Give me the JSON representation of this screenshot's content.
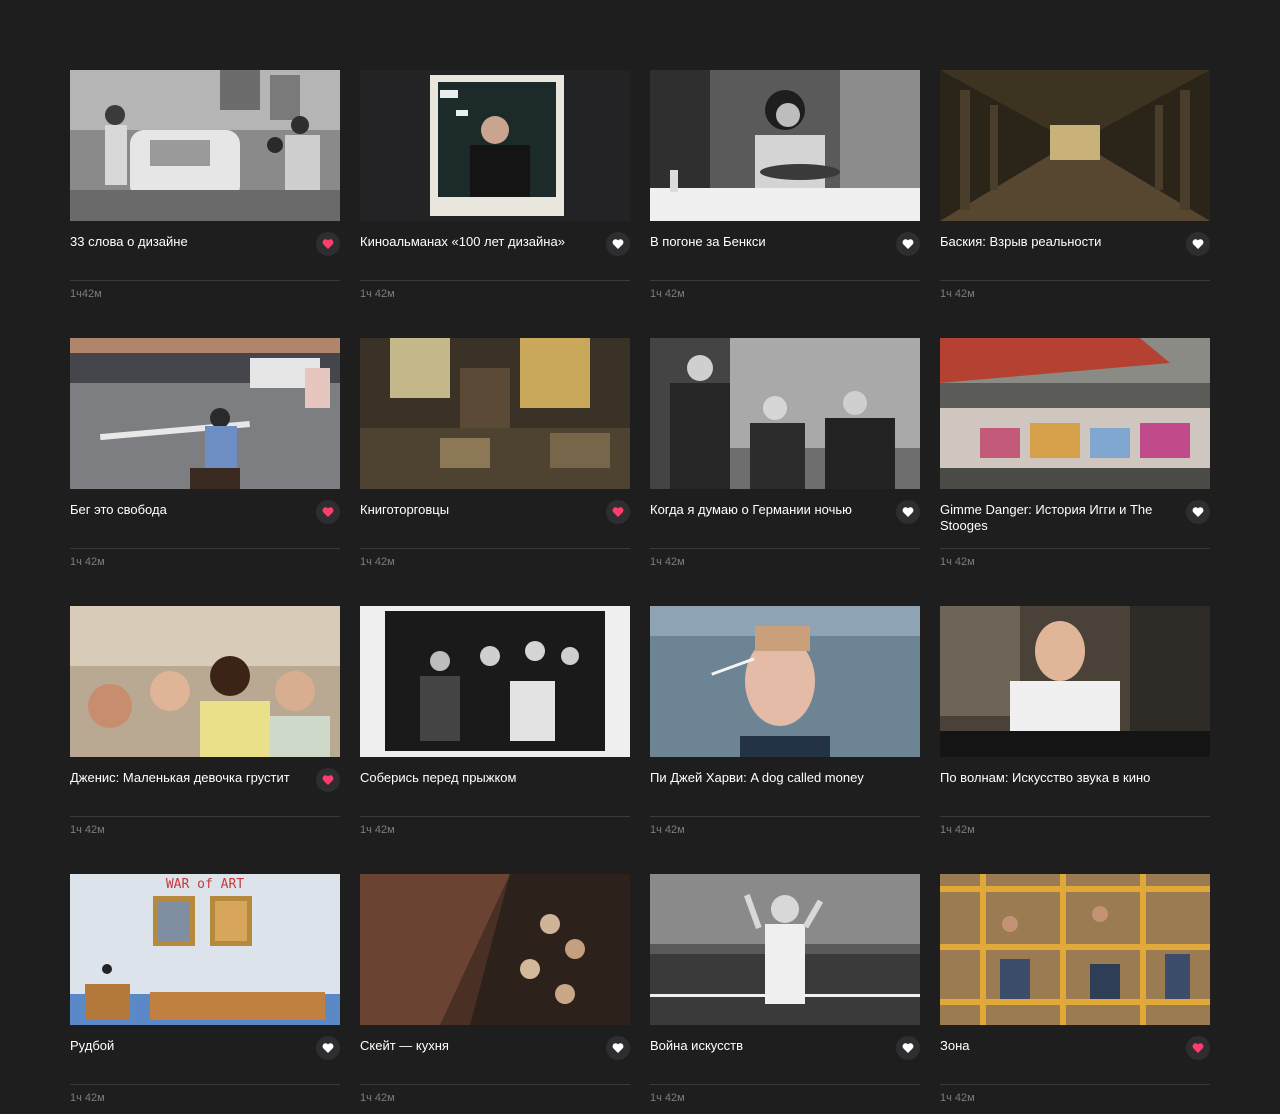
{
  "colors": {
    "background": "#1e1e1f",
    "favorite_active": "#ff3d6e",
    "favorite_inactive": "#ffffff",
    "duration_text": "#7c7c80"
  },
  "films": [
    {
      "title": "33 слова о дизайне",
      "duration": "1ч42м",
      "favorite": true,
      "icon": "heart-icon"
    },
    {
      "title": "Киноальманах «100 лет дизайна»",
      "duration": "1ч 42м",
      "favorite": false,
      "icon": "heart-icon"
    },
    {
      "title": "В погоне за Бенкси",
      "duration": "1ч 42м",
      "favorite": false,
      "icon": "heart-icon"
    },
    {
      "title": "Баския: Взрыв реальности",
      "duration": "1ч 42м",
      "favorite": false,
      "icon": "heart-icon"
    },
    {
      "title": "Бег это свобода",
      "duration": "1ч 42м",
      "favorite": true,
      "icon": "heart-icon"
    },
    {
      "title": "Книготорговцы",
      "duration": "1ч 42м",
      "favorite": true,
      "icon": "heart-icon"
    },
    {
      "title": "Когда я думаю о Германии ночью",
      "duration": "1ч 42м",
      "favorite": false,
      "icon": "heart-icon"
    },
    {
      "title": "Gimme Danger: История Игги и The Stooges",
      "duration": "1ч 42м",
      "favorite": false,
      "icon": "heart-icon"
    },
    {
      "title": "Дженис: Маленькая девочка грустит",
      "duration": "1ч 42м",
      "favorite": true,
      "icon": "heart-icon"
    },
    {
      "title": "Соберись перед прыжком",
      "duration": "1ч 42м",
      "favorite": null,
      "icon": null
    },
    {
      "title": "Пи Джей Харви: A dog called money",
      "duration": "1ч 42м",
      "favorite": null,
      "icon": null
    },
    {
      "title": "По волнам: Искусство звука в кино",
      "duration": "1ч 42м",
      "favorite": null,
      "icon": null
    },
    {
      "title": "Рудбой",
      "duration": "1ч 42м",
      "favorite": false,
      "icon": "heart-icon"
    },
    {
      "title": "Скейт — кухня",
      "duration": "1ч 42м",
      "favorite": false,
      "icon": "heart-icon"
    },
    {
      "title": "Война искусств",
      "duration": "1ч 42м",
      "favorite": false,
      "icon": "heart-icon"
    },
    {
      "title": "Зона",
      "duration": "1ч 42м",
      "favorite": true,
      "icon": "heart-icon"
    }
  ],
  "thumbnail_art": {
    "poster_text_war_of_art": "WAR of ART"
  }
}
